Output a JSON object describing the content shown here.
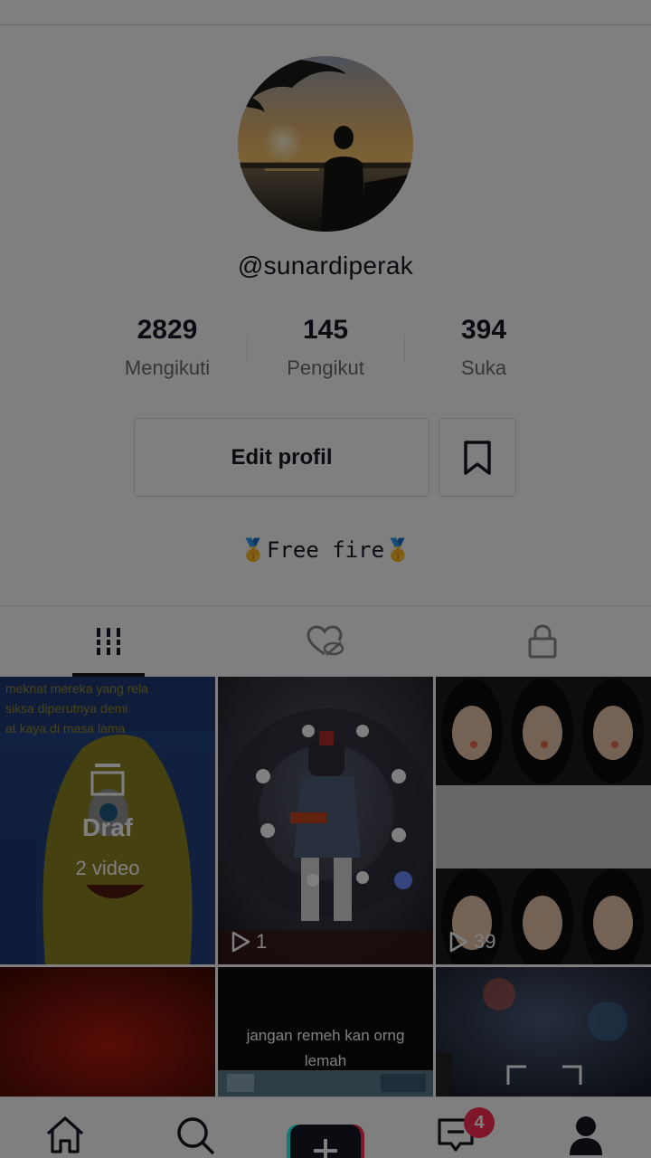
{
  "profile": {
    "username": "@sunardiperak",
    "bio": {
      "medal_left": "🥇",
      "text": "Free fire",
      "medal_right": "🥇"
    },
    "avatar_icon": "avatar-sunset-photo"
  },
  "stats": [
    {
      "value": "2829",
      "label": "Mengikuti"
    },
    {
      "value": "145",
      "label": "Pengikut"
    },
    {
      "value": "394",
      "label": "Suka"
    }
  ],
  "actions": {
    "edit_label": "Edit profil",
    "bookmark_icon": "bookmark-icon"
  },
  "tabs": [
    {
      "icon": "grid-icon",
      "active": true
    },
    {
      "icon": "liked-hidden-icon",
      "active": false
    },
    {
      "icon": "lock-icon",
      "active": false
    }
  ],
  "draft": {
    "title": "Draf",
    "count": "2 video"
  },
  "videos": [
    {
      "views": "1"
    },
    {
      "views": "39"
    }
  ],
  "caption_tile": {
    "line1": "jangan remeh kan orng",
    "line2": "lemah"
  },
  "nav": {
    "items": [
      "home-icon",
      "search-icon",
      "create-icon",
      "inbox-icon",
      "profile-icon"
    ],
    "inbox_badge": "4"
  },
  "colors": {
    "accent": "#fe2c55",
    "create_cyan": "#25f4ee",
    "text": "#161823",
    "muted": "#6b6c73"
  }
}
